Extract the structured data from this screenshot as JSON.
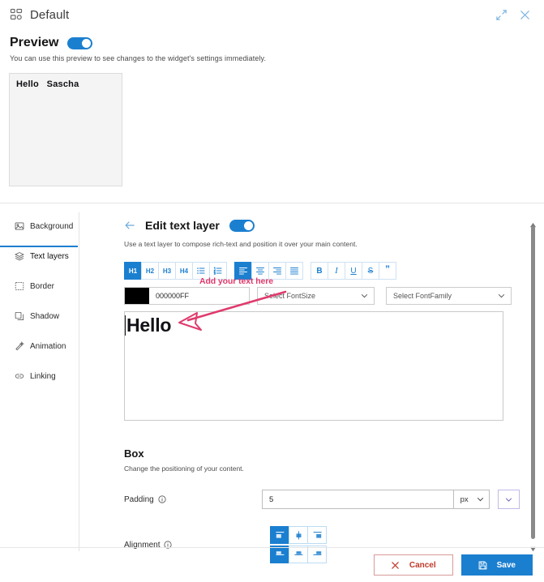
{
  "window": {
    "title": "Default",
    "icon": "widget-grid-icon",
    "expand_label": "expand-icon",
    "close_label": "close-icon"
  },
  "preview": {
    "title": "Preview",
    "toggle_on": true,
    "description": "You can use this preview to see changes to the widget's settings immediately.",
    "content": "Hello   Sascha"
  },
  "sidebar": {
    "items": [
      {
        "label": "Background",
        "icon": "image-icon",
        "active": false
      },
      {
        "label": "Text layers",
        "icon": "text-layers-icon",
        "active": true
      },
      {
        "label": "Border",
        "icon": "border-icon",
        "active": false
      },
      {
        "label": "Shadow",
        "icon": "shadow-icon",
        "active": false
      },
      {
        "label": "Animation",
        "icon": "animation-icon",
        "active": false
      },
      {
        "label": "Linking",
        "icon": "link-icon",
        "active": false
      }
    ]
  },
  "panel": {
    "back_label": "back-arrow",
    "title": "Edit text layer",
    "toggle_on": true,
    "description": "Use a text layer to compose rich-text and position it over your main content."
  },
  "toolbar": {
    "headings": [
      {
        "label": "H1",
        "active": true
      },
      {
        "label": "H2",
        "active": false
      },
      {
        "label": "H3",
        "active": false
      },
      {
        "label": "H4",
        "active": false
      }
    ],
    "lists": [
      {
        "name": "bullet-list-icon",
        "active": false
      },
      {
        "name": "numbered-list-icon",
        "active": false
      }
    ],
    "aligns": [
      {
        "name": "align-left-icon",
        "active": true
      },
      {
        "name": "align-center-icon",
        "active": false
      },
      {
        "name": "align-right-icon",
        "active": false
      },
      {
        "name": "align-justify-icon",
        "active": false
      }
    ],
    "formats": [
      {
        "label": "B",
        "name": "bold-button",
        "class": "bold"
      },
      {
        "label": "I",
        "name": "italic-button",
        "class": "italic"
      },
      {
        "label": "U",
        "name": "underline-button",
        "class": "under"
      },
      {
        "label": "S",
        "name": "strikethrough-button",
        "class": "strike"
      },
      {
        "label": "”",
        "name": "blockquote-button",
        "class": "quote"
      }
    ]
  },
  "font_row": {
    "color_value": "000000FF",
    "color_swatch": "#000000",
    "fontsize_placeholder": "Select FontSize",
    "fontfamily_placeholder": "Select FontFamily"
  },
  "editor": {
    "content": "Hello"
  },
  "box": {
    "title": "Box",
    "description": "Change the positioning of your content.",
    "padding_label": "Padding",
    "padding_value": "5",
    "padding_unit": "px",
    "alignment_label": "Alignment",
    "alignment_row1": [
      {
        "name": "align-top-left-icon",
        "active": true
      },
      {
        "name": "align-top-center-icon",
        "active": false
      },
      {
        "name": "align-top-right-icon",
        "active": false
      }
    ],
    "alignment_row2": [
      {
        "name": "align-middle-left-icon",
        "active": true
      },
      {
        "name": "align-middle-center-icon",
        "active": false
      },
      {
        "name": "align-middle-right-icon",
        "active": false
      }
    ]
  },
  "footer": {
    "cancel_label": "Cancel",
    "save_label": "Save"
  },
  "annotation": {
    "text": "Add your text here",
    "color": "#e03a6d"
  },
  "colors": {
    "accent_blue": "#1b7fd0",
    "annotation_pink": "#e03a6d",
    "cancel_red": "#c0392b"
  }
}
